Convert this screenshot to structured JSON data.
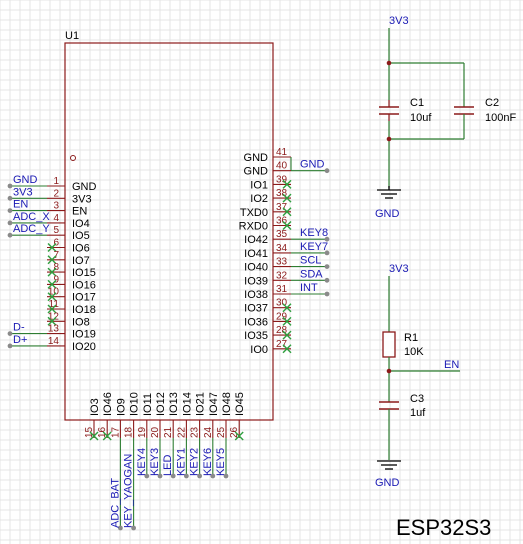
{
  "title": "ESP32S3",
  "chip": {
    "ref": "U1",
    "left_pins": [
      {
        "num": "1",
        "name": "GND",
        "net": "GND"
      },
      {
        "num": "2",
        "name": "3V3",
        "net": "3V3"
      },
      {
        "num": "3",
        "name": "EN",
        "net": "EN"
      },
      {
        "num": "4",
        "name": "IO4",
        "net": "ADC_X"
      },
      {
        "num": "5",
        "name": "IO5",
        "net": "ADC_Y"
      },
      {
        "num": "6",
        "name": "IO6",
        "net": ""
      },
      {
        "num": "7",
        "name": "IO7",
        "net": ""
      },
      {
        "num": "8",
        "name": "IO15",
        "net": ""
      },
      {
        "num": "9",
        "name": "IO16",
        "net": ""
      },
      {
        "num": "10",
        "name": "IO17",
        "net": ""
      },
      {
        "num": "11",
        "name": "IO18",
        "net": ""
      },
      {
        "num": "12",
        "name": "IO8",
        "net": ""
      },
      {
        "num": "13",
        "name": "IO19",
        "net": "D-"
      },
      {
        "num": "14",
        "name": "IO20",
        "net": "D+"
      }
    ],
    "right_pins": [
      {
        "num": "41",
        "name": "GND",
        "net": ""
      },
      {
        "num": "40",
        "name": "GND",
        "net": "GND"
      },
      {
        "num": "39",
        "name": "IO1",
        "net": ""
      },
      {
        "num": "38",
        "name": "IO2",
        "net": ""
      },
      {
        "num": "37",
        "name": "TXD0",
        "net": ""
      },
      {
        "num": "36",
        "name": "RXD0",
        "net": ""
      },
      {
        "num": "35",
        "name": "IO42",
        "net": "KEY8"
      },
      {
        "num": "34",
        "name": "IO41",
        "net": "KEY7"
      },
      {
        "num": "33",
        "name": "IO40",
        "net": "SCL"
      },
      {
        "num": "32",
        "name": "IO39",
        "net": "SDA"
      },
      {
        "num": "31",
        "name": "IO38",
        "net": "INT"
      },
      {
        "num": "30",
        "name": "IO37",
        "net": ""
      },
      {
        "num": "29",
        "name": "IO36",
        "net": ""
      },
      {
        "num": "28",
        "name": "IO35",
        "net": ""
      },
      {
        "num": "27",
        "name": "IO0",
        "net": ""
      }
    ],
    "bottom_pins": [
      {
        "num": "15",
        "name": "IO3",
        "net": ""
      },
      {
        "num": "16",
        "name": "IO46",
        "net": ""
      },
      {
        "num": "17",
        "name": "IO9",
        "net": "ADC_BAT"
      },
      {
        "num": "18",
        "name": "IO10",
        "net": "KEY_YAOGAN"
      },
      {
        "num": "19",
        "name": "IO11",
        "net": "KEY4"
      },
      {
        "num": "20",
        "name": "IO12",
        "net": "KEY3"
      },
      {
        "num": "21",
        "name": "IO13",
        "net": "LED"
      },
      {
        "num": "22",
        "name": "IO14",
        "net": "KEY1"
      },
      {
        "num": "23",
        "name": "IO21",
        "net": "KEY2"
      },
      {
        "num": "24",
        "name": "IO47",
        "net": "KEY6"
      },
      {
        "num": "25",
        "name": "IO48",
        "net": "KEY5"
      },
      {
        "num": "26",
        "name": "IO45",
        "net": ""
      }
    ]
  },
  "power_circuit": {
    "supply": "3V3",
    "ground": "GND",
    "c1_ref": "C1",
    "c1_value": "10uf",
    "c2_ref": "C2",
    "c2_value": "100nF"
  },
  "reset_circuit": {
    "supply": "3V3",
    "ground": "GND",
    "r1_ref": "R1",
    "r1_value": "10K",
    "c3_ref": "C3",
    "c3_value": "1uf",
    "net": "EN"
  },
  "colors": {
    "grid": "#e4e4e4",
    "body": "#8b1a1a",
    "pin": "#8b1a1a",
    "wire": "#2e7d32",
    "net_label": "#1a1ab4",
    "no_connect": "#2e9e3e",
    "junction": "#8a8a8a"
  }
}
